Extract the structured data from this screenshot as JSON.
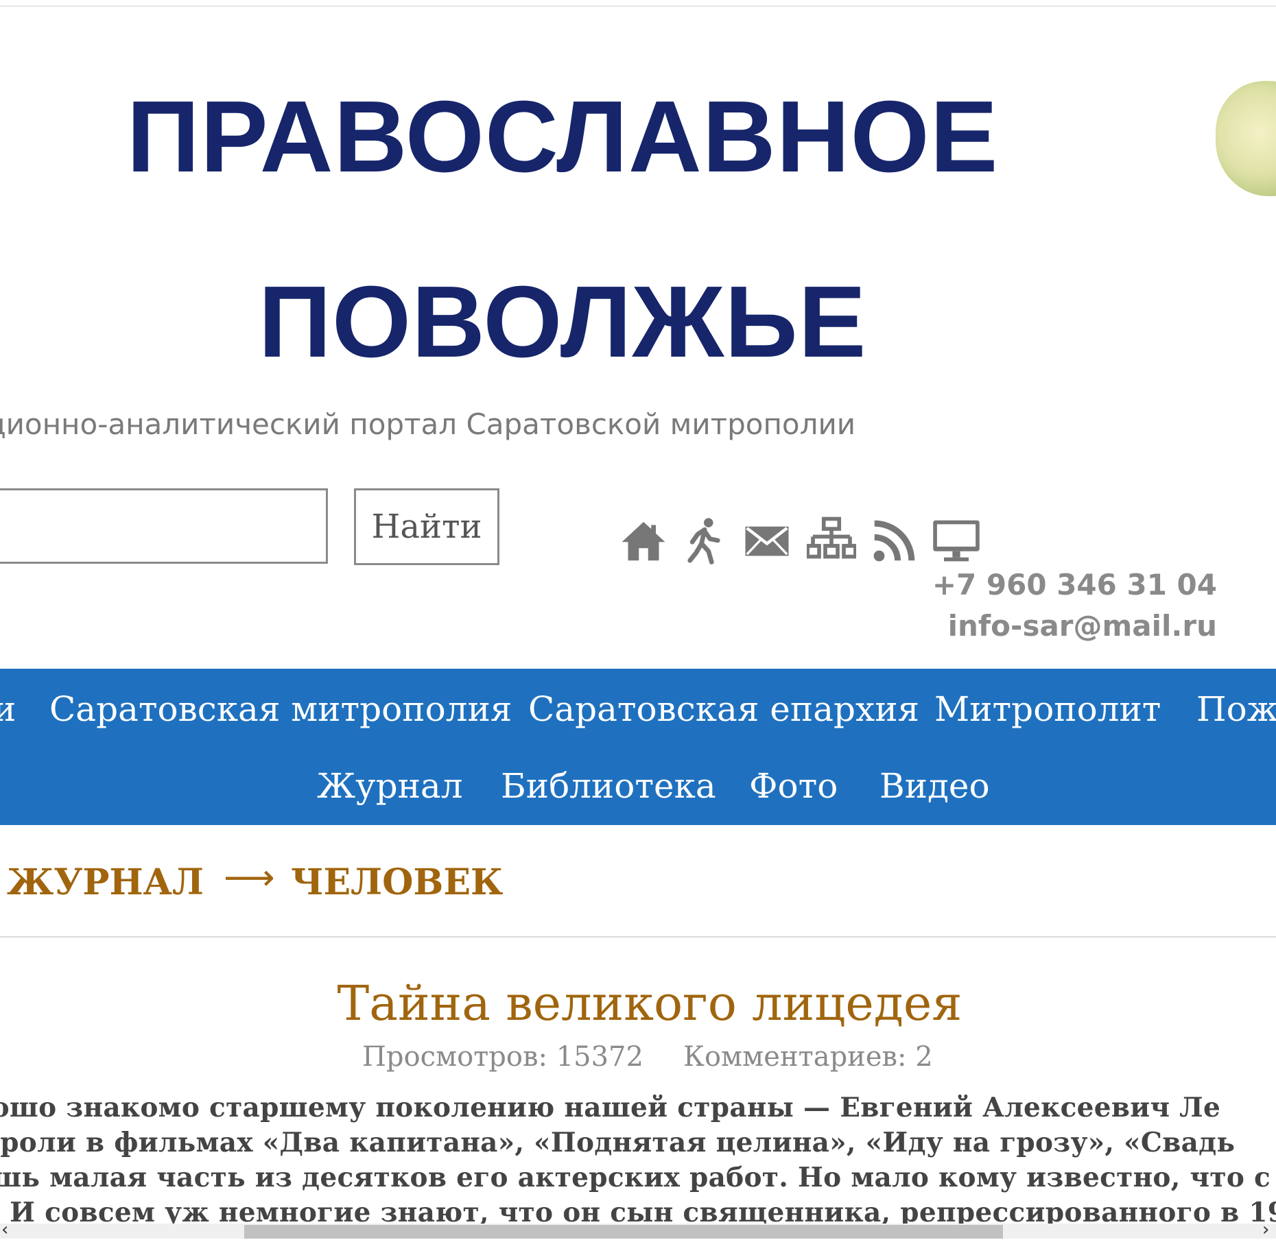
{
  "site": {
    "title_line1": "ПРАВОСЛАВНОЕ",
    "title_line2": "ПОВОЛЖЬЕ",
    "tagline": "ционно-аналитический портал Саратовской митрополии"
  },
  "search": {
    "placeholder": "",
    "value": "",
    "button_label": "Найти"
  },
  "icons": [
    "home-icon",
    "walking-person-icon",
    "mail-icon",
    "sitemap-icon",
    "rss-icon",
    "monitor-icon"
  ],
  "contacts": {
    "phone": "+7 960 346 31 04",
    "email": "info-sar@mail.ru"
  },
  "nav": {
    "row1": [
      "и",
      "Саратовская митрополия",
      "Саратовская епархия",
      "Митрополит",
      "Пож"
    ],
    "row2": [
      "Журнал",
      "Библиотека",
      "Фото",
      "Видео"
    ]
  },
  "breadcrumb": {
    "items": [
      "ЖУРНАЛ",
      "ЧЕЛОВЕК"
    ],
    "separator": "⟶"
  },
  "article": {
    "title": "Тайна великого лицедея",
    "views": "Просмотров: 15372",
    "comments": "Комментариев: 2",
    "lines": [
      "рошо знакомо старшему поколению нашей страны — Евгений Алексеевич Ле",
      "о роли в фильмах «Два капитана», «Поднятая целина», «Иду на грозу», «Свадь",
      "ишь малая часть из десятков его актерских работ. Но мало кому известно, что с",
      "о. И совсем уж немногие знают, что он сын священника, репрессированного в 19"
    ]
  },
  "colors": {
    "title": "#17256b",
    "nav_background": "#1f71bf",
    "accent": "#a0650d",
    "muted_text": "#8a8a8a"
  }
}
